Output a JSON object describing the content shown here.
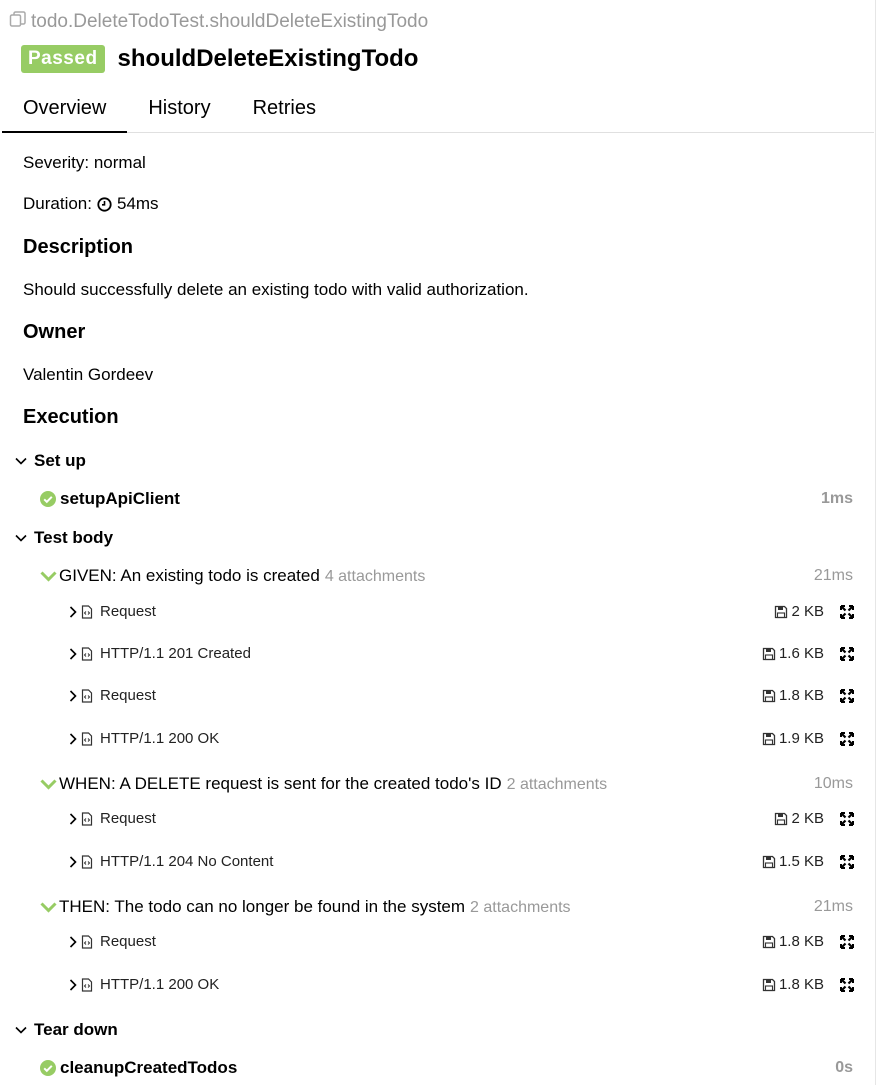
{
  "header": {
    "path": "todo.DeleteTodoTest.shouldDeleteExistingTodo",
    "status": "Passed",
    "title": "shouldDeleteExistingTodo"
  },
  "tabs": [
    "Overview",
    "History",
    "Retries"
  ],
  "overview": {
    "severity": "Severity: normal",
    "duration_label": "Duration:",
    "duration_value": "54ms",
    "description_heading": "Description",
    "description": "Should successfully delete an existing todo with valid authorization.",
    "owner_heading": "Owner",
    "owner": "Valentin Gordeev",
    "execution_heading": "Execution"
  },
  "setup": {
    "label": "Set up",
    "fixture": "setupApiClient",
    "time": "1ms"
  },
  "body": {
    "label": "Test body",
    "steps": [
      {
        "name": "GIVEN: An existing todo is created",
        "attachments": "4 attachments",
        "time": "21ms",
        "items": [
          {
            "label": "Request",
            "size": "2 KB"
          },
          {
            "label": "HTTP/1.1 201 Created",
            "size": "1.6 KB"
          },
          {
            "label": "Request",
            "size": "1.8 KB"
          },
          {
            "label": "HTTP/1.1 200 OK",
            "size": "1.9 KB"
          }
        ]
      },
      {
        "name": "WHEN: A DELETE request is sent for the created todo's ID",
        "attachments": "2 attachments",
        "time": "10ms",
        "items": [
          {
            "label": "Request",
            "size": "2 KB"
          },
          {
            "label": "HTTP/1.1 204 No Content",
            "size": "1.5 KB"
          }
        ]
      },
      {
        "name": "THEN: The todo can no longer be found in the system",
        "attachments": "2 attachments",
        "time": "21ms",
        "items": [
          {
            "label": "Request",
            "size": "1.8 KB"
          },
          {
            "label": "HTTP/1.1 200 OK",
            "size": "1.8 KB"
          }
        ]
      }
    ]
  },
  "teardown": {
    "label": "Tear down",
    "fixture": "cleanupCreatedTodos",
    "time": "0s"
  },
  "colors": {
    "passed": "#97cc64",
    "muted": "#999999"
  },
  "icons": {
    "path": "copy-icon",
    "duration": "clock-icon",
    "section": "chevron-down-icon",
    "fixture": "check-circle-icon",
    "step": "chevron-down-icon",
    "attachment_toggle": "chevron-right-icon",
    "attachment": "file-code-icon",
    "size": "save-icon",
    "expand": "expand-icon"
  }
}
